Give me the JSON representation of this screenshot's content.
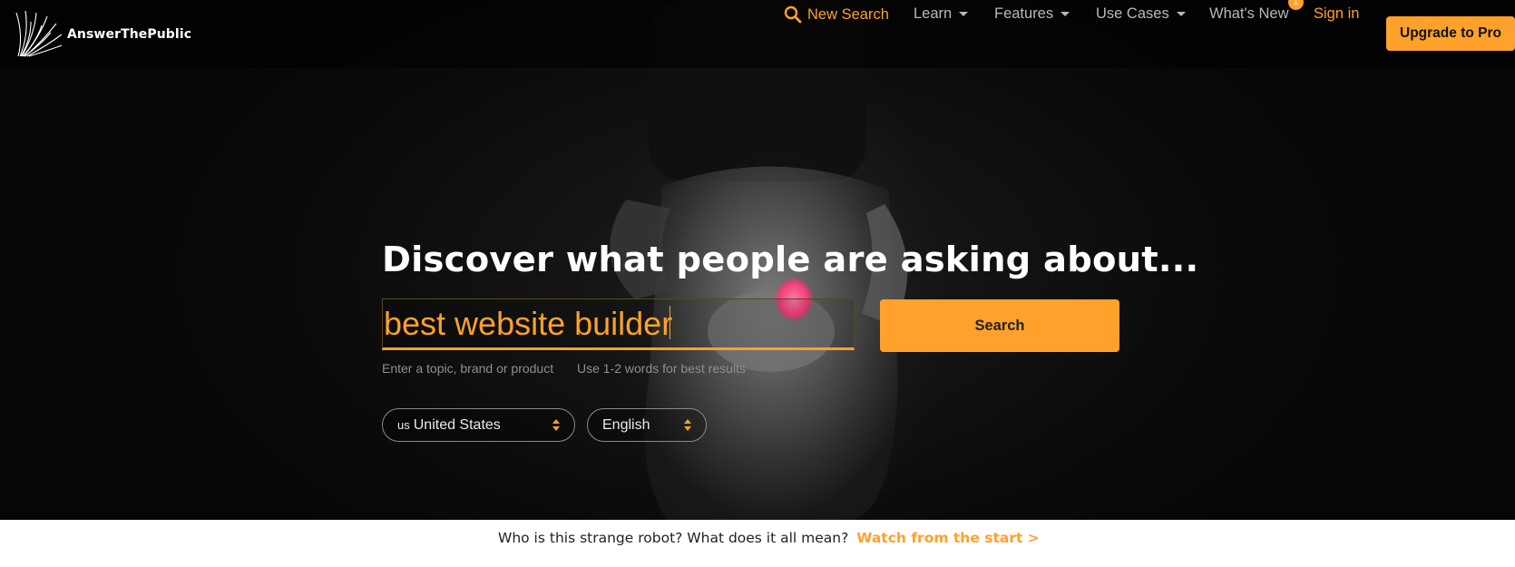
{
  "brand": {
    "name": "AnswerThePublic",
    "accent": "#ffa12a"
  },
  "nav": {
    "new_search": "New Search",
    "learn": "Learn",
    "features": "Features",
    "use_cases": "Use Cases",
    "whats_new": "What's New",
    "whats_new_badge": "1",
    "sign_in": "Sign in",
    "upgrade": "Upgrade to Pro"
  },
  "hero": {
    "headline": "Discover what people are asking about...",
    "search": {
      "value": "best website builder",
      "button": "Search",
      "hint_left": "Enter a topic, brand or product",
      "hint_right": "Use 1-2 words for best results"
    },
    "country": {
      "code": "us",
      "name": "United States"
    },
    "language": "English"
  },
  "footer": {
    "text": "Who is this strange robot? What does it all mean?",
    "link": "Watch from the start >"
  }
}
